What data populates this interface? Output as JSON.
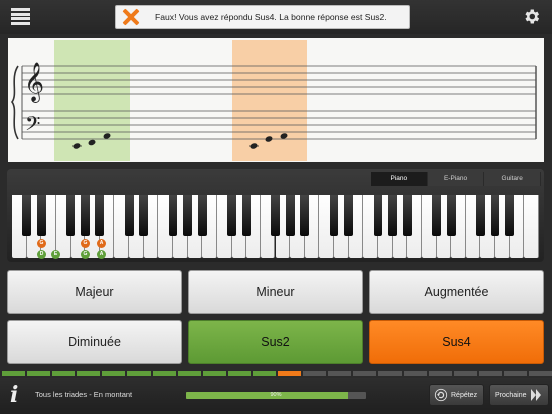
{
  "feedback": {
    "message": "Faux! Vous avez répondu Sus4. La bonne réponse est Sus2.",
    "icon": "close-icon",
    "icon_color": "#ef7a1a"
  },
  "toolbar": {
    "menu_icon": "list-menu-icon",
    "settings_icon": "gear-icon"
  },
  "staff": {
    "clefs": [
      "treble",
      "bass"
    ],
    "highlights": [
      {
        "meaning": "correct",
        "color": "#cfe5b4"
      },
      {
        "meaning": "wrong",
        "color": "#f8cfa6"
      }
    ]
  },
  "instrument_tabs": [
    {
      "label": "Piano",
      "active": true
    },
    {
      "label": "E-Piano",
      "active": false
    },
    {
      "label": "Guitare",
      "active": false
    }
  ],
  "key_markers": [
    {
      "label": "G",
      "color": "#e06a1a"
    },
    {
      "label": "D",
      "color": "#5f9f3a"
    },
    {
      "label": "E",
      "color": "#5f9f3a"
    },
    {
      "label": "G",
      "color": "#e06a1a"
    },
    {
      "label": "G",
      "color": "#5f9f3a"
    },
    {
      "label": "A",
      "color": "#e06a1a"
    },
    {
      "label": "A",
      "color": "#5f9f3a"
    }
  ],
  "answers": [
    {
      "label": "Majeur",
      "state": "normal"
    },
    {
      "label": "Mineur",
      "state": "normal"
    },
    {
      "label": "Augmentée",
      "state": "normal"
    },
    {
      "label": "Diminuée",
      "state": "normal"
    },
    {
      "label": "Sus2",
      "state": "correct"
    },
    {
      "label": "Sus4",
      "state": "wrong"
    }
  ],
  "bottom": {
    "series_label": "Tous les triades - En montant",
    "progress_percent": 90,
    "progress_text": "90%",
    "repeat_label": "Répétez",
    "next_label": "Prochaine"
  },
  "question_progress": {
    "completed": 11,
    "current_index": 12,
    "total": 22
  },
  "colors": {
    "correct": "#5f9f3a",
    "wrong": "#f07a1a"
  }
}
